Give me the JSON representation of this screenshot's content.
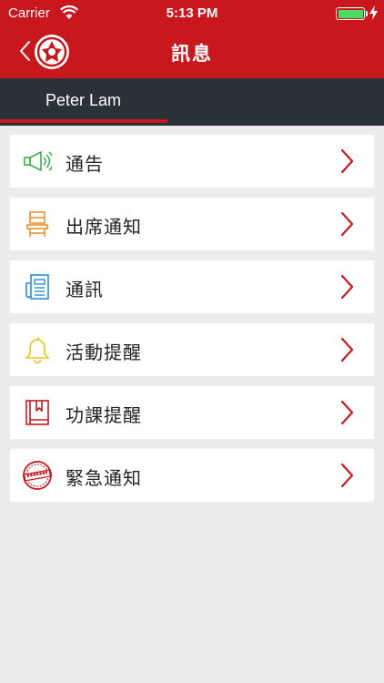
{
  "status_bar": {
    "carrier": "Carrier",
    "time": "5:13 PM",
    "battery_level": 1.0
  },
  "nav": {
    "title": "訊息",
    "back_icon": "chevron-left-icon",
    "logo_icon": "school-emblem-icon"
  },
  "user": {
    "name": "Peter Lam"
  },
  "menu": {
    "items": [
      {
        "label": "通告",
        "icon": "megaphone-icon"
      },
      {
        "label": "出席通知",
        "icon": "chair-icon"
      },
      {
        "label": "通訊",
        "icon": "newspaper-icon"
      },
      {
        "label": "活動提醒",
        "icon": "bell-icon"
      },
      {
        "label": "功課提醒",
        "icon": "book-icon"
      },
      {
        "label": "緊急通知",
        "icon": "urgent-stamp-icon"
      }
    ]
  },
  "colors": {
    "brand_red": "#c8171d",
    "user_bar": "#2b3138",
    "background": "#ececec",
    "megaphone": "#3cb04a",
    "chair": "#e8922e",
    "newspaper": "#2a8fd6",
    "bell": "#f0c419",
    "book": "#c8171d",
    "urgent": "#c8171d"
  }
}
